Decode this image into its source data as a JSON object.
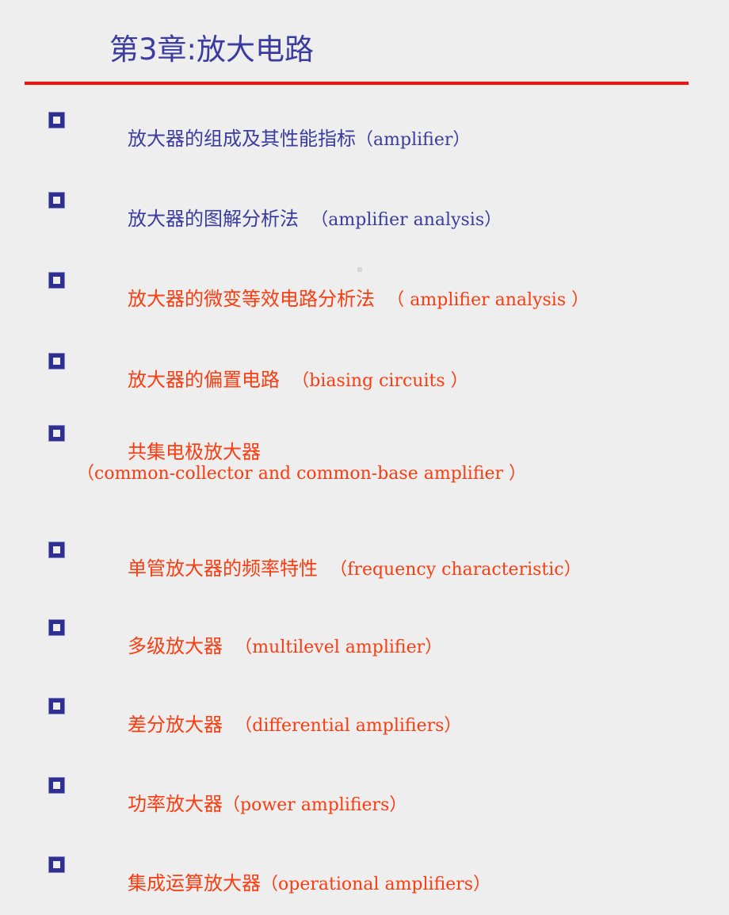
{
  "slide": {
    "background_color": "#eeeeee",
    "title": "第3章:放大电路",
    "title_color": "#3b3ba0",
    "divider_color": "#fa1008",
    "bullet_marker_color": "#2f2f92",
    "accent_orange": "#fa3c10",
    "bullet_glyph": "square-outline-bullet-icon"
  },
  "items": [
    {
      "cn": "放大器的组成及其性能指标",
      "en": "（amplifier）",
      "color": "blue",
      "second_line": ""
    },
    {
      "cn": "放大器的图解分析法  ",
      "en": "（amplifier analysis）",
      "color": "blue",
      "second_line": ""
    },
    {
      "cn": "放大器的微变等效电路分析法  ",
      "en": "（ amplifier analysis ）",
      "color": "orange",
      "second_line": ""
    },
    {
      "cn": "放大器的偏置电路  ",
      "en": "（biasing circuits ）",
      "color": "orange",
      "second_line": ""
    },
    {
      "cn": "共集电极放大器",
      "en": "",
      "color": "orange",
      "second_line": "（common-collector and common-base amplifier ）"
    },
    {
      "cn": "单管放大器的频率特性  ",
      "en": "（frequency characteristic）",
      "color": "orange",
      "second_line": ""
    },
    {
      "cn": "多级放大器  ",
      "en": "（multilevel amplifier）",
      "color": "orange",
      "second_line": ""
    },
    {
      "cn": "差分放大器  ",
      "en": "（differential amplifiers）",
      "color": "orange",
      "second_line": ""
    },
    {
      "cn": "功率放大器",
      "en": "（power amplifiers）",
      "color": "orange",
      "second_line": ""
    },
    {
      "cn": "集成运算放大器",
      "en": "（operational amplifiers）",
      "color": "orange",
      "second_line": ""
    }
  ]
}
